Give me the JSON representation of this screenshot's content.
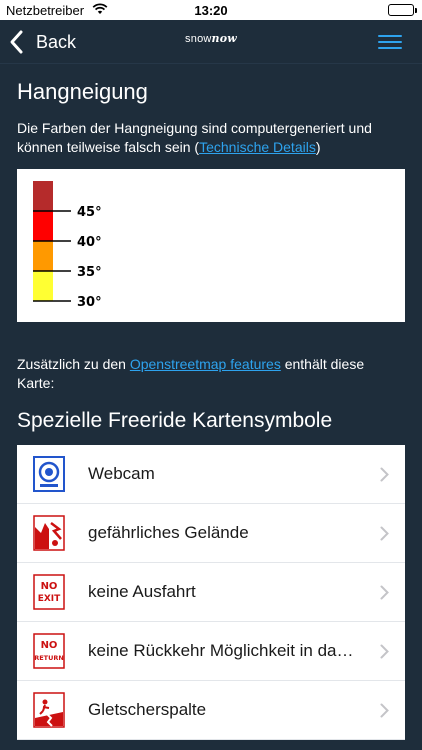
{
  "status_bar": {
    "carrier": "Netzbetreiber",
    "time": "13:20"
  },
  "nav": {
    "back_label": "Back",
    "logo_normal": "snow",
    "logo_bold": "now"
  },
  "page": {
    "title": "Hangneigung",
    "desc_text": "Die Farben der Hangneigung sind computergeneriert und können teilweise falsch sein (",
    "desc_link": "Technische Details",
    "desc_end": ")",
    "legend": {
      "colors": [
        "#b52b2b",
        "#ff0000",
        "#ff9900",
        "#ffff33"
      ],
      "labels": [
        "45°",
        "40°",
        "35°",
        "30°"
      ]
    },
    "extra_text_1": "Zusätzlich zu den ",
    "extra_link": "Openstreetmap features",
    "extra_text_2": " enthält diese Karte:",
    "section_title": "Spezielle Freeride Kartensymbole"
  },
  "symbols": [
    {
      "label": "Webcam",
      "icon": "webcam-icon"
    },
    {
      "label": "gefährliches Gelände",
      "icon": "dangerous-terrain-icon"
    },
    {
      "label": "keine Ausfahrt",
      "icon": "no-exit-icon",
      "sign_line1": "NO",
      "sign_line2": "EXIT"
    },
    {
      "label": "keine Rückkehr Möglichkeit in das Skigebiet",
      "icon": "no-return-icon",
      "sign_line1": "NO",
      "sign_line2": "RETURN"
    },
    {
      "label": "Gletscherspalte",
      "icon": "crevasse-icon"
    }
  ]
}
